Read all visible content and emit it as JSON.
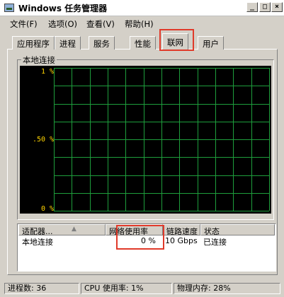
{
  "window": {
    "title": "Windows 任务管理器",
    "controls": [
      "_",
      "□",
      "×"
    ]
  },
  "menu": [
    "文件(F)",
    "选项(O)",
    "查看(V)",
    "帮助(H)"
  ],
  "tabs": [
    {
      "label": "应用程序",
      "active": false
    },
    {
      "label": "进程",
      "active": false
    },
    {
      "label": "服务",
      "active": false
    },
    {
      "label": "性能",
      "active": false
    },
    {
      "label": "联网",
      "active": true
    },
    {
      "label": "用户",
      "active": false
    }
  ],
  "network": {
    "group_label": "本地连接",
    "graph": {
      "y_labels": [
        "1 %",
        ".50 %",
        "0 %"
      ],
      "background": "#000000",
      "grid_color": "#1e9e3c",
      "label_color": "#ffd400"
    },
    "columns": [
      "适配器...",
      "网络使用率",
      "链路速度",
      "状态"
    ],
    "rows": [
      {
        "adapter": "本地连接",
        "utilization": "0 %",
        "link_speed": "10 Gbps",
        "state": "已连接"
      }
    ]
  },
  "statusbar": {
    "processes": "进程数: 36",
    "cpu": "CPU 使用率: 1%",
    "memory": "物理内存: 28%"
  },
  "colors": {
    "highlight": "#e03a2a",
    "face": "#d4d0c8"
  }
}
